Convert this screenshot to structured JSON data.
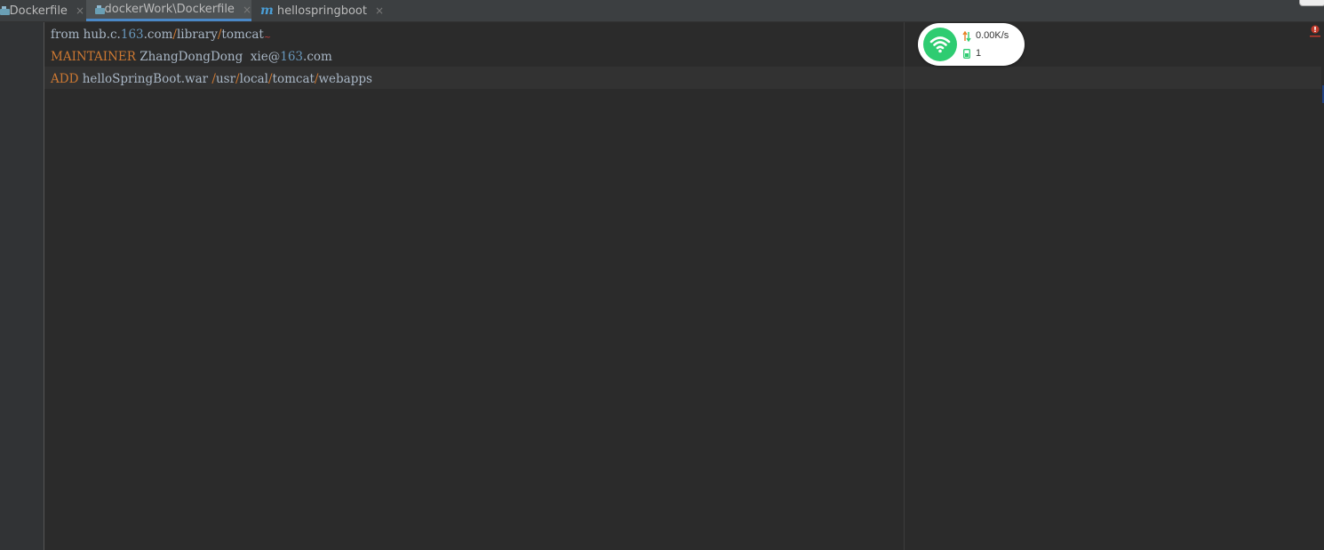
{
  "tabs": [
    {
      "label": "Dockerfile",
      "icon": "docker-file-icon",
      "close": "×",
      "active": false
    },
    {
      "label": "dockerWork\\Dockerfile",
      "icon": "docker-file-icon",
      "close": "×",
      "active": true
    },
    {
      "label": "hellospringboot",
      "icon": "maven-m-icon",
      "icon_glyph": "m",
      "close": "×",
      "active": false
    }
  ],
  "editor": {
    "lines": [
      {
        "segments": [
          "from hub.c.",
          "163",
          ".com",
          "/",
          "library",
          "/",
          "tomcat",
          "~"
        ]
      },
      {
        "segments": [
          "MAINTAINER",
          " ZhangDongDong  xie@",
          "163",
          ".com"
        ]
      },
      {
        "segments": [
          "ADD",
          " helloSpringBoot.war ",
          "/",
          "usr",
          "/",
          "local",
          "/",
          "tomcat",
          "/",
          "webapps"
        ]
      }
    ]
  },
  "net_widget": {
    "speed": "0.00K/s",
    "connections": "1",
    "accent": "#2ecc71"
  },
  "colors": {
    "background": "#2b2b2b",
    "keyword": "#cc7832",
    "number": "#6897bb",
    "text": "#a9b7c6",
    "active_tab_underline": "#4a88c7"
  }
}
